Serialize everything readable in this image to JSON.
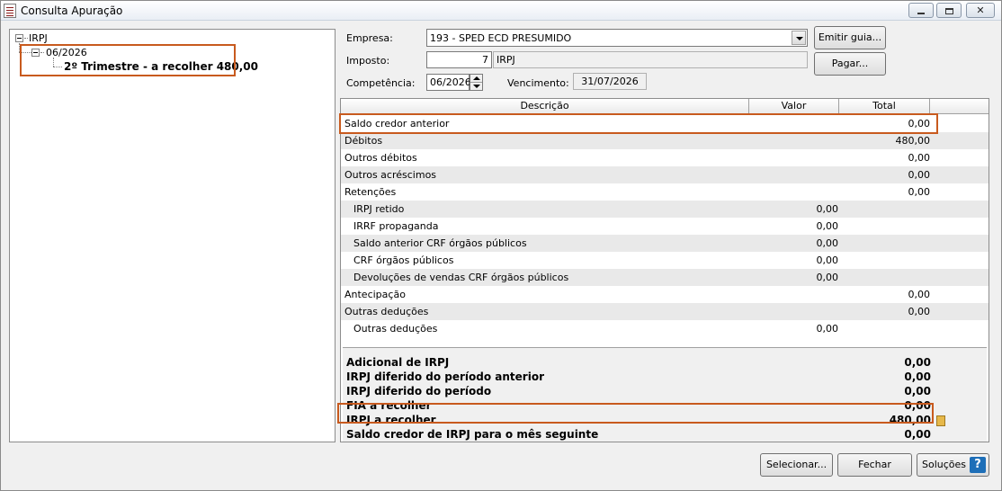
{
  "window": {
    "title": "Consulta Apuração",
    "icons": {
      "app": "document-list-icon",
      "minimize": "minimize-icon",
      "maximize": "maximize-icon",
      "close": "close-icon"
    }
  },
  "tree": {
    "root": "IRPJ",
    "period": "06/2026",
    "leaf": "2º Trimestre - a recolher 480,00"
  },
  "form": {
    "empresa_label": "Empresa:",
    "empresa_value": "193 - SPED ECD PRESUMIDO",
    "imposto_label": "Imposto:",
    "imposto_code": "7",
    "imposto_name": "IRPJ",
    "competencia_label": "Competência:",
    "competencia_value": "06/2026",
    "vencimento_label": "Vencimento:",
    "vencimento_value": "31/07/2026",
    "emitir_guia_label": "Emitir guia...",
    "pagar_label": "Pagar..."
  },
  "grid": {
    "columns": [
      "Descrição",
      "Valor",
      "Total"
    ],
    "rows": [
      {
        "desc": "Saldo credor anterior",
        "valor": "",
        "total": "0,00",
        "indent": false
      },
      {
        "desc": "Débitos",
        "valor": "",
        "total": "480,00",
        "indent": false
      },
      {
        "desc": "Outros débitos",
        "valor": "",
        "total": "0,00",
        "indent": false
      },
      {
        "desc": "Outros acréscimos",
        "valor": "",
        "total": "0,00",
        "indent": false
      },
      {
        "desc": "Retenções",
        "valor": "",
        "total": "0,00",
        "indent": false
      },
      {
        "desc": "IRPJ retido",
        "valor": "0,00",
        "total": "",
        "indent": true
      },
      {
        "desc": "IRRF propaganda",
        "valor": "0,00",
        "total": "",
        "indent": true
      },
      {
        "desc": "Saldo anterior CRF órgãos públicos",
        "valor": "0,00",
        "total": "",
        "indent": true
      },
      {
        "desc": "CRF órgãos públicos",
        "valor": "0,00",
        "total": "",
        "indent": true
      },
      {
        "desc": "Devoluções de vendas CRF órgãos públicos",
        "valor": "0,00",
        "total": "",
        "indent": true
      },
      {
        "desc": "Antecipação",
        "valor": "",
        "total": "0,00",
        "indent": false
      },
      {
        "desc": "Outras deduções",
        "valor": "",
        "total": "0,00",
        "indent": false
      },
      {
        "desc": "Outras deduções",
        "valor": "0,00",
        "total": "",
        "indent": true
      }
    ],
    "summary": [
      {
        "desc": "Adicional de IRPJ",
        "value": "0,00"
      },
      {
        "desc": "IRPJ diferido do período anterior",
        "value": "0,00"
      },
      {
        "desc": "IRPJ diferido do período",
        "value": "0,00"
      },
      {
        "desc": "FIA a recolher",
        "value": "0,00"
      },
      {
        "desc": "IRPJ a recolher",
        "value": "480,00"
      },
      {
        "desc": "Saldo credor de IRPJ para o mês seguinte",
        "value": "0,00"
      }
    ]
  },
  "footer": {
    "selecionar_label": "Selecionar...",
    "fechar_label": "Fechar",
    "solucoes_label": "Soluções"
  },
  "colors": {
    "highlight": "#c85a1e",
    "alt_row": "#e9e9e9"
  }
}
